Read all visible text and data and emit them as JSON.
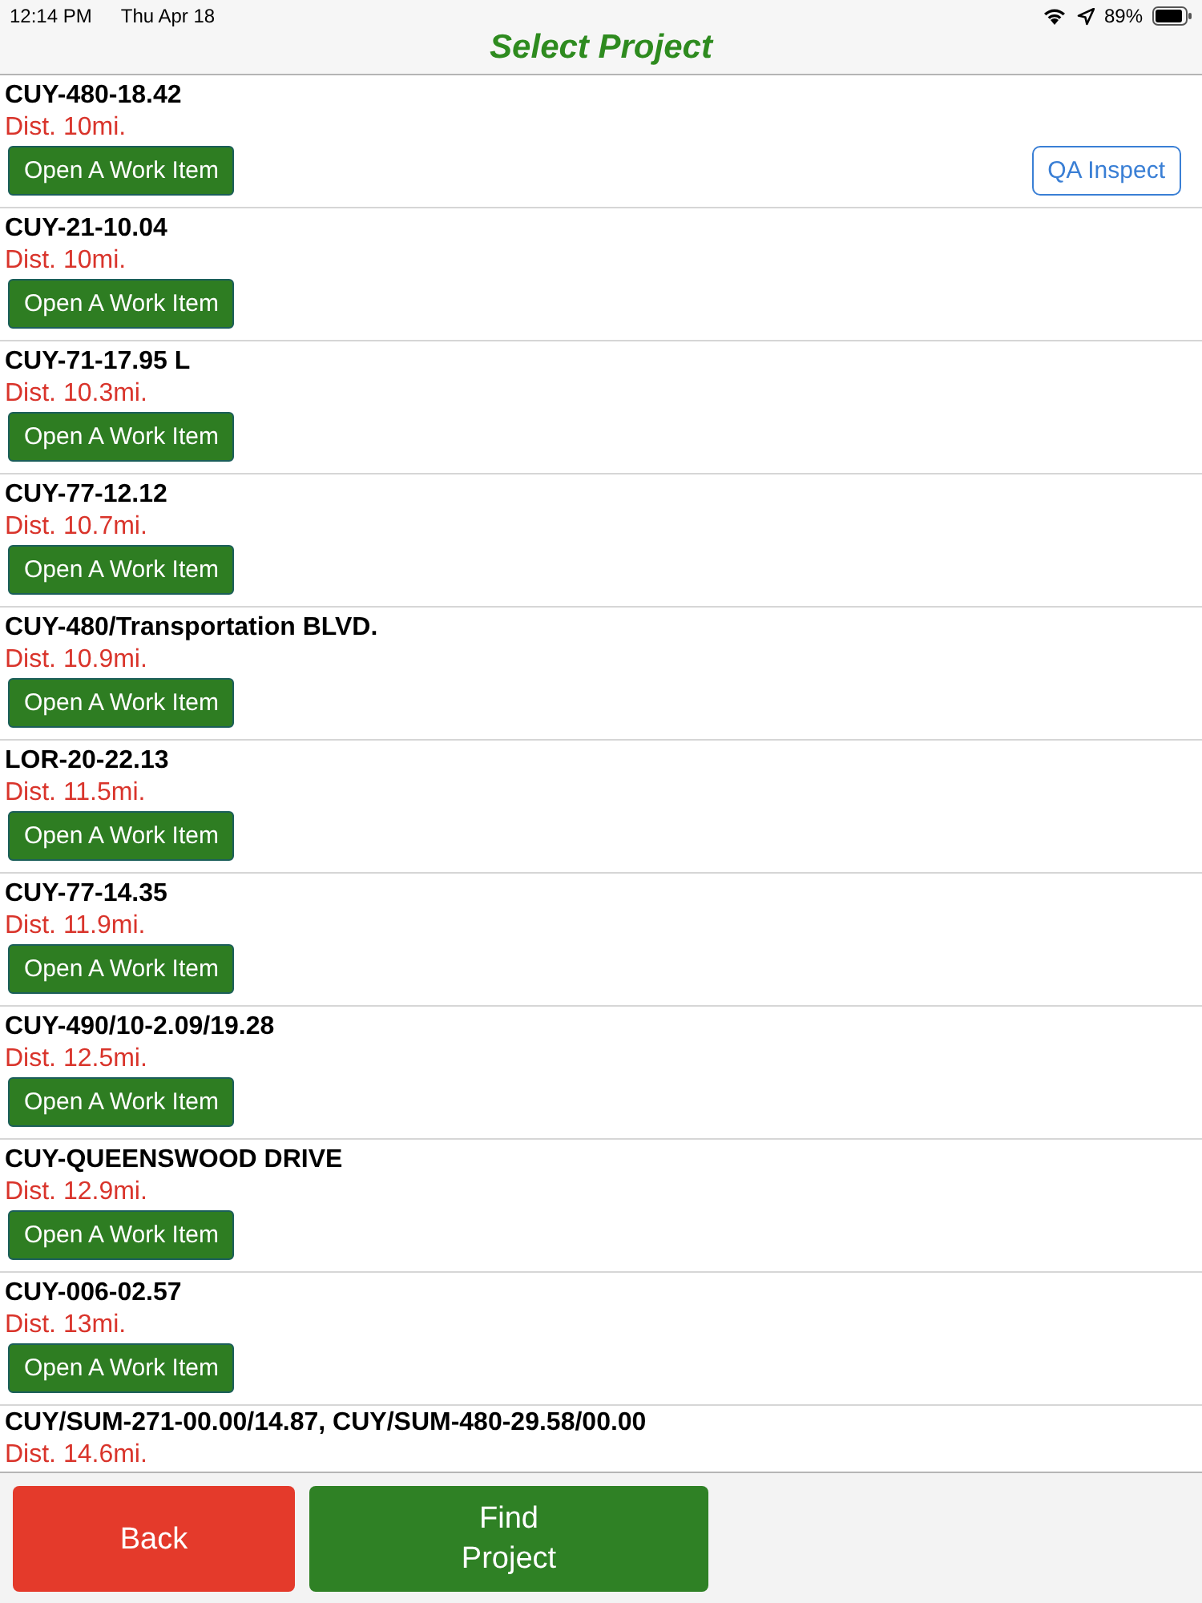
{
  "status_bar": {
    "time": "12:14 PM",
    "date": "Thu Apr 18",
    "battery": "89%"
  },
  "title": "Select Project",
  "projects": [
    {
      "name": "CUY-480-18.42",
      "distance": "Dist. 10mi.",
      "open_button": "Open A Work Item",
      "qa_button": "QA Inspect"
    },
    {
      "name": "CUY-21-10.04",
      "distance": "Dist. 10mi.",
      "open_button": "Open A Work Item"
    },
    {
      "name": "CUY-71-17.95 L",
      "distance": "Dist. 10.3mi.",
      "open_button": "Open A Work Item"
    },
    {
      "name": "CUY-77-12.12",
      "distance": "Dist. 10.7mi.",
      "open_button": "Open A Work Item"
    },
    {
      "name": "CUY-480/Transportation BLVD.",
      "distance": "Dist. 10.9mi.",
      "open_button": "Open A Work Item"
    },
    {
      "name": "LOR-20-22.13",
      "distance": "Dist. 11.5mi.",
      "open_button": "Open A Work Item"
    },
    {
      "name": "CUY-77-14.35",
      "distance": "Dist. 11.9mi.",
      "open_button": "Open A Work Item"
    },
    {
      "name": "CUY-490/10-2.09/19.28",
      "distance": "Dist. 12.5mi.",
      "open_button": "Open A Work Item"
    },
    {
      "name": "CUY-QUEENSWOOD DRIVE",
      "distance": "Dist. 12.9mi.",
      "open_button": "Open A Work Item"
    },
    {
      "name": "CUY-006-02.57",
      "distance": "Dist. 13mi.",
      "open_button": "Open A Work Item"
    },
    {
      "name": "CUY/SUM-271-00.00/14.87, CUY/SUM-480-29.58/00.00",
      "distance": "Dist. 14.6mi."
    }
  ],
  "footer": {
    "back_button": "Back",
    "find_button": "Find Project"
  }
}
